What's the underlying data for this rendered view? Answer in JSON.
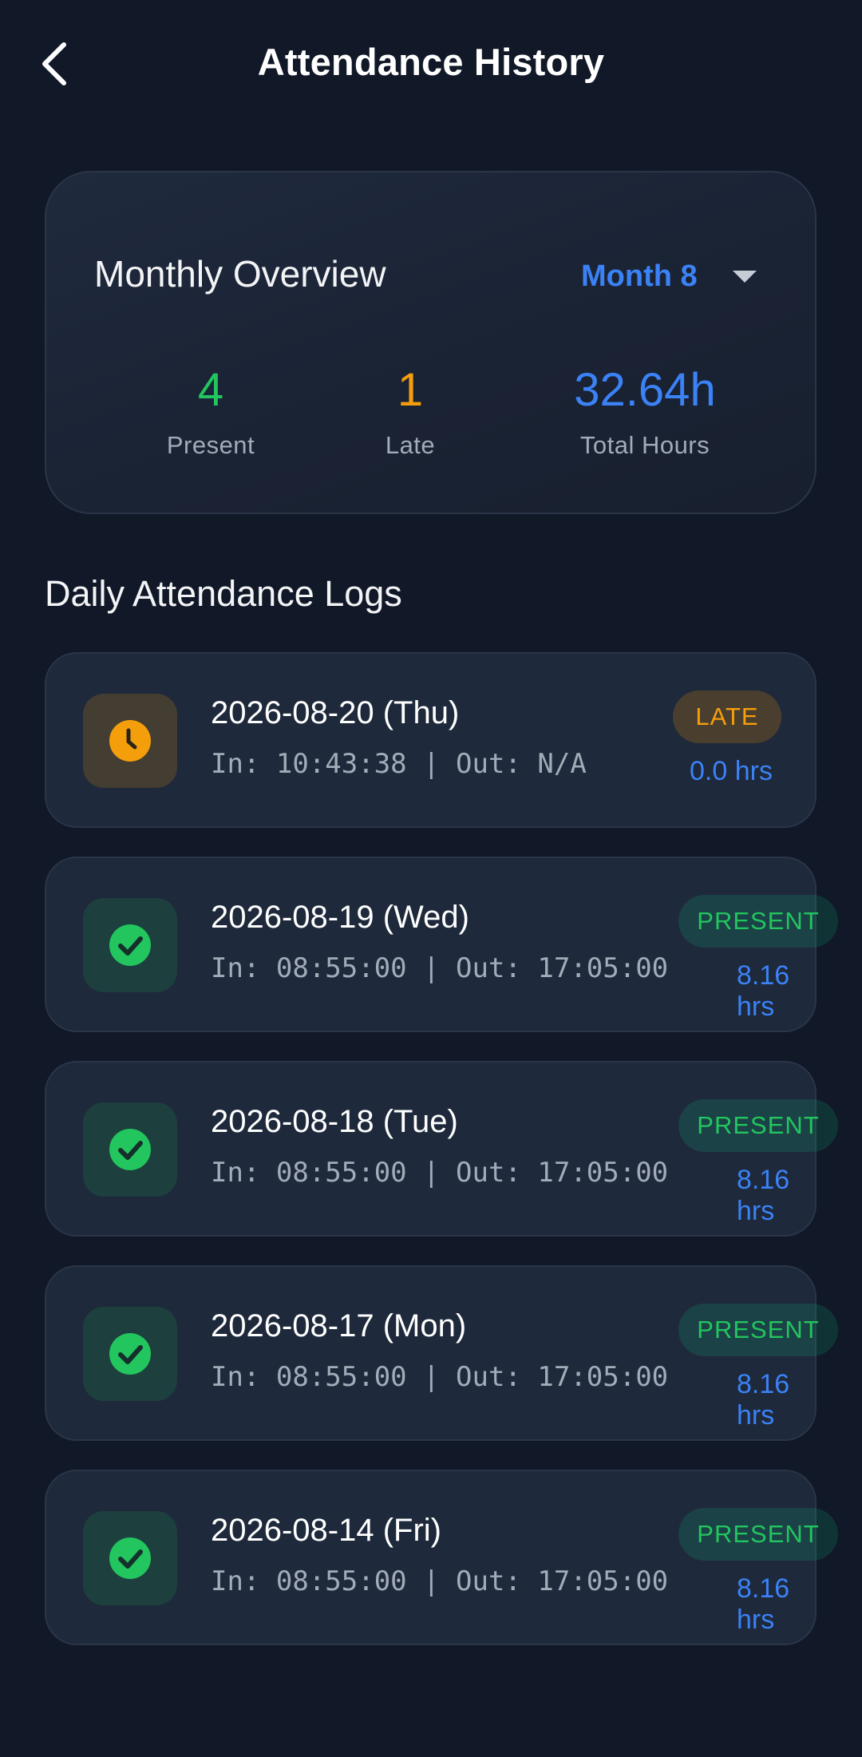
{
  "header": {
    "title": "Attendance History"
  },
  "overview": {
    "title": "Monthly Overview",
    "month": "Month 8",
    "stats": [
      {
        "value": "4",
        "label": "Present",
        "color": "#22c55e"
      },
      {
        "value": "1",
        "label": "Late",
        "color": "#f59e0b"
      },
      {
        "value": "32.64h",
        "label": "Total Hours",
        "color": "#3b82f6"
      }
    ]
  },
  "logs": {
    "title": "Daily Attendance Logs",
    "items": [
      {
        "date": "2026-08-20 (Thu)",
        "times": "In: 10:43:38 | Out: N/A",
        "status": "LATE",
        "hours": "0.0 hrs",
        "icon": "clock-icon"
      },
      {
        "date": "2026-08-19 (Wed)",
        "times": "In: 08:55:00 | Out: 17:05:00",
        "status": "PRESENT",
        "hours": "8.16 hrs",
        "icon": "check-circle-icon"
      },
      {
        "date": "2026-08-18 (Tue)",
        "times": "In: 08:55:00 | Out: 17:05:00",
        "status": "PRESENT",
        "hours": "8.16 hrs",
        "icon": "check-circle-icon"
      },
      {
        "date": "2026-08-17 (Mon)",
        "times": "In: 08:55:00 | Out: 17:05:00",
        "status": "PRESENT",
        "hours": "8.16 hrs",
        "icon": "check-circle-icon"
      },
      {
        "date": "2026-08-14 (Fri)",
        "times": "In: 08:55:00 | Out: 17:05:00",
        "status": "PRESENT",
        "hours": "8.16 hrs",
        "icon": "check-circle-icon"
      }
    ]
  },
  "colors": {
    "background": "#111827",
    "card": "#1e293b",
    "accent_blue": "#3b82f6",
    "present_green": "#22c55e",
    "late_amber": "#f59e0b"
  }
}
